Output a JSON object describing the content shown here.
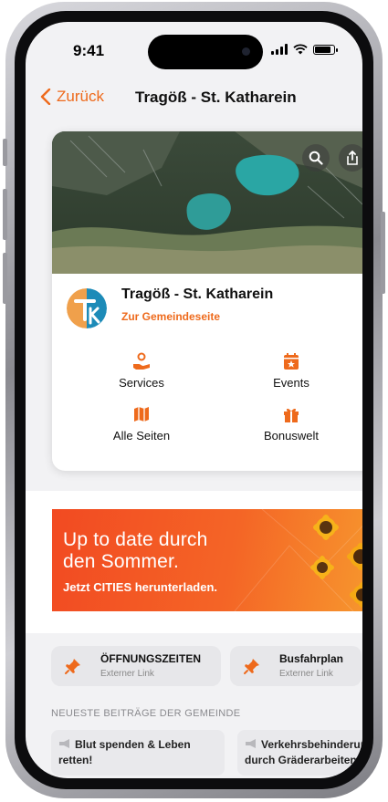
{
  "status": {
    "time": "9:41"
  },
  "nav": {
    "back_label": "Zurück",
    "title": "Tragöß - St. Katharein"
  },
  "municipality": {
    "name": "Tragöß - St. Katharein",
    "link_label": "Zur Gemeindeseite"
  },
  "tiles": [
    {
      "label": "Services",
      "icon": "hand-gear-icon"
    },
    {
      "label": "Events",
      "icon": "calendar-star-icon"
    },
    {
      "label": "Alle Seiten",
      "icon": "map-icon"
    },
    {
      "label": "Bonuswelt",
      "icon": "gift-icon"
    }
  ],
  "banner": {
    "line1": "Up to date durch",
    "line2": "den Sommer.",
    "cta": "Jetzt CITIES herunterladen."
  },
  "quick_links": [
    {
      "title": "ÖFFNUNGSZEITEN",
      "subtitle": "Externer Link",
      "icon": "pushpin-icon"
    },
    {
      "title": "Busfahrplan",
      "subtitle": "Externer Link",
      "icon": "pushpin-icon"
    }
  ],
  "news": {
    "header": "NEUESTE BEITRÄGE DER GEMEINDE",
    "items": [
      {
        "line1": "Blut spenden & Leben",
        "line2": "retten!"
      },
      {
        "line1": "Verkehrsbehinderung",
        "line2": "durch Gräderarbeiten"
      }
    ]
  },
  "colors": {
    "accent": "#ee6a1c",
    "banner": "#f24a22",
    "background": "#f2f2f4"
  }
}
